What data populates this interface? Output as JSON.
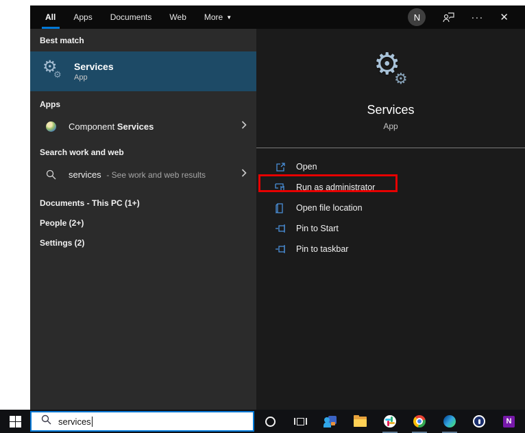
{
  "topbar": {
    "tabs": [
      {
        "label": "All",
        "active": true
      },
      {
        "label": "Apps",
        "active": false
      },
      {
        "label": "Documents",
        "active": false
      },
      {
        "label": "Web",
        "active": false
      },
      {
        "label": "More",
        "active": false
      }
    ],
    "avatar_letter": "N",
    "ellipsis": "···",
    "close": "✕"
  },
  "left_panel": {
    "best_match_header": "Best match",
    "best_match": {
      "title": "Services",
      "subtitle": "App"
    },
    "apps_header": "Apps",
    "apps_result": {
      "prefix": "Component",
      "bold": "Services"
    },
    "search_header": "Search work and web",
    "web_result": {
      "query": "services",
      "suffix": "- See work and web results"
    },
    "documents_header": "Documents - This PC (1+)",
    "people_header": "People (2+)",
    "settings_header": "Settings (2)"
  },
  "right_panel": {
    "title": "Services",
    "subtitle": "App",
    "actions": [
      {
        "label": "Open",
        "icon": "open-icon"
      },
      {
        "label": "Run as administrator",
        "icon": "admin-shield-icon",
        "annotated": true
      },
      {
        "label": "Open file location",
        "icon": "file-location-icon"
      },
      {
        "label": "Pin to Start",
        "icon": "pin-icon"
      },
      {
        "label": "Pin to taskbar",
        "icon": "pin-icon"
      }
    ]
  },
  "taskbar": {
    "search_value": "services",
    "onenote_letter": "N",
    "icons": [
      "cortana",
      "task-view",
      "teams",
      "file-explorer",
      "slack",
      "chrome",
      "edge",
      "1password",
      "onenote"
    ],
    "running_icons": [
      "slack",
      "chrome",
      "edge"
    ]
  },
  "colors": {
    "accent": "#0078d7",
    "best_match_highlight": "#1d4a66",
    "annotation_red": "#e60000",
    "action_icon_blue": "#4a90d9",
    "left_panel_bg": "#2b2b2b",
    "right_panel_bg": "#1b1b1b",
    "topbar_bg": "#0b0b0b",
    "taskbar_bg": "#101114"
  },
  "icon_glyphs": {
    "gear": "⚙"
  }
}
